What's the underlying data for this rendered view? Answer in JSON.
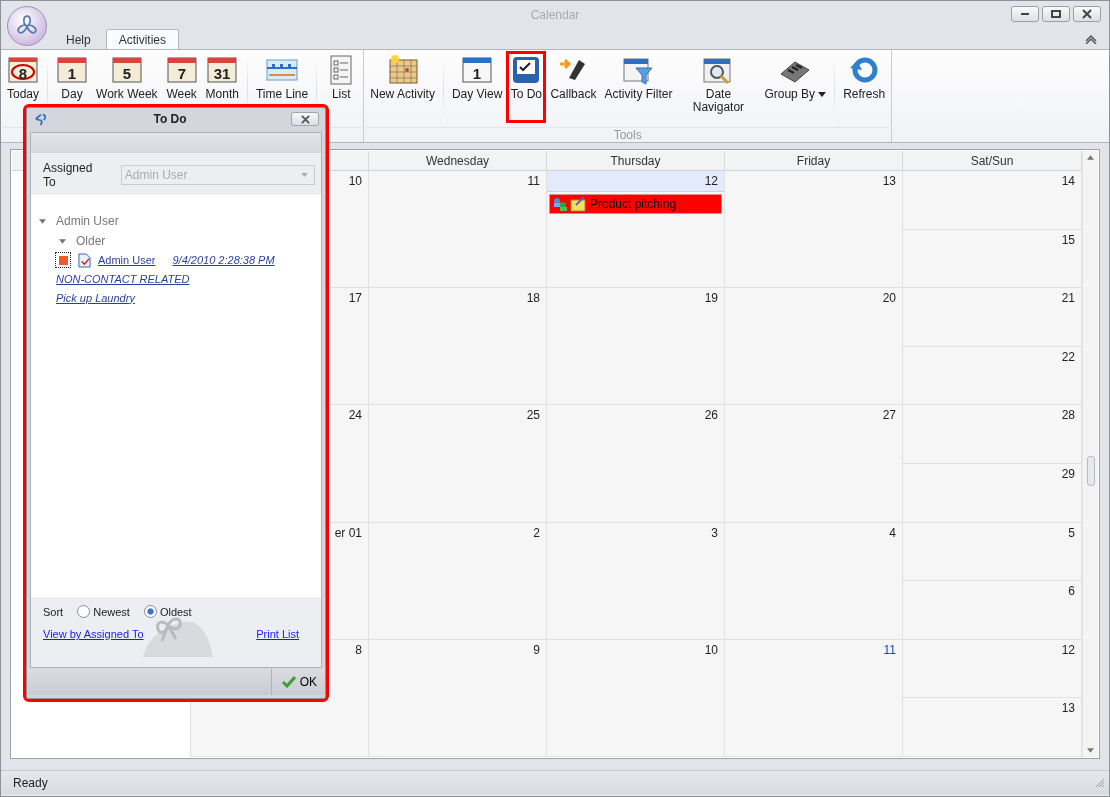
{
  "window": {
    "title": "Calendar"
  },
  "tabs": [
    {
      "label": "Help",
      "selected": false
    },
    {
      "label": "Activities",
      "selected": true
    }
  ],
  "ribbon": {
    "groups": [
      {
        "sections": [
          [
            {
              "label": "Today",
              "kind": "today",
              "icon_text": "8",
              "highlighted": false
            }
          ],
          [
            {
              "label": "Day",
              "kind": "calendar",
              "icon_text": "1",
              "highlighted": false
            },
            {
              "label": "Work Week",
              "kind": "calendar",
              "icon_text": "5",
              "highlighted": false
            },
            {
              "label": "Week",
              "kind": "calendar",
              "icon_text": "7",
              "highlighted": false
            },
            {
              "label": "Month",
              "kind": "calendar",
              "icon_text": "31",
              "highlighted": false
            }
          ],
          [
            {
              "label": "Time Line",
              "kind": "timeline",
              "highlighted": false
            }
          ],
          [
            {
              "label": "List",
              "kind": "list",
              "highlighted": false
            }
          ]
        ]
      },
      {
        "label": "Tools",
        "sections": [
          [
            {
              "label": "New Activity",
              "kind": "new-activity",
              "highlighted": false
            }
          ],
          [
            {
              "label": "Day View",
              "kind": "day-view",
              "icon_text": "1",
              "highlighted": false
            },
            {
              "label": "To Do",
              "kind": "todo",
              "highlighted": true
            },
            {
              "label": "Callback",
              "kind": "callback",
              "highlighted": false
            },
            {
              "label": "Activity Filter",
              "kind": "filter",
              "highlighted": false
            },
            {
              "label": "Date Navigator",
              "kind": "navigator",
              "highlighted": false
            },
            {
              "label": "Group By",
              "kind": "group",
              "has_menu": true,
              "highlighted": false
            }
          ],
          [
            {
              "label": "Refresh",
              "kind": "refresh",
              "highlighted": false
            }
          ]
        ]
      }
    ]
  },
  "calendar": {
    "columns": [
      "Wednesday",
      "Thursday",
      "Friday",
      "Sat/Sun"
    ],
    "weeks": [
      {
        "days": [
          {
            "date": "10",
            "today": false,
            "marked": false
          },
          {
            "date": "11",
            "today": false,
            "marked": false
          },
          {
            "date": "12",
            "today": true,
            "marked": false,
            "events": [
              {
                "title": "Product pitching",
                "color": "#ff0000"
              }
            ]
          },
          {
            "date": "13",
            "today": false,
            "marked": false
          }
        ],
        "weekend": [
          {
            "date": "14",
            "marked": false
          },
          {
            "date": "15",
            "marked": false
          }
        ]
      },
      {
        "days": [
          {
            "date": "17",
            "today": false,
            "marked": false
          },
          {
            "date": "18",
            "today": false,
            "marked": false
          },
          {
            "date": "19",
            "today": false,
            "marked": false
          },
          {
            "date": "20",
            "today": false,
            "marked": false
          }
        ],
        "weekend": [
          {
            "date": "21",
            "marked": false
          },
          {
            "date": "22",
            "marked": false
          }
        ]
      },
      {
        "days": [
          {
            "date": "24",
            "today": false,
            "marked": false
          },
          {
            "date": "25",
            "today": false,
            "marked": false
          },
          {
            "date": "26",
            "today": false,
            "marked": false
          },
          {
            "date": "27",
            "today": false,
            "marked": false
          }
        ],
        "weekend": [
          {
            "date": "28",
            "marked": false
          },
          {
            "date": "29",
            "marked": false
          }
        ]
      },
      {
        "days": [
          {
            "date": "er 01",
            "today": false,
            "marked": false
          },
          {
            "date": "2",
            "today": false,
            "marked": false
          },
          {
            "date": "3",
            "today": false,
            "marked": false
          },
          {
            "date": "4",
            "today": false,
            "marked": false
          }
        ],
        "weekend": [
          {
            "date": "5",
            "marked": false
          },
          {
            "date": "6",
            "marked": false
          }
        ]
      },
      {
        "days": [
          {
            "date": "8",
            "today": false,
            "marked": false
          },
          {
            "date": "9",
            "today": false,
            "marked": false
          },
          {
            "date": "10",
            "today": false,
            "marked": false
          },
          {
            "date": "11",
            "today": false,
            "marked": true
          }
        ],
        "weekend": [
          {
            "date": "12",
            "marked": false
          },
          {
            "date": "13",
            "marked": false
          }
        ]
      }
    ]
  },
  "dialog": {
    "title": "To Do",
    "highlighted": true,
    "assigned_to": {
      "label": "Assigned To",
      "value": "Admin User",
      "disabled": true
    },
    "tree": [
      {
        "label": "Admin User",
        "expanded": true,
        "children": [
          {
            "label": "Older",
            "expanded": true,
            "items": [
              {
                "assignee": "Admin User",
                "date": "9/4/2010 2:28:38 PM",
                "category": "NON-CONTACT RELATED",
                "subject": "Pick up Laundry"
              }
            ]
          }
        ]
      }
    ],
    "sort": {
      "label": "Sort",
      "options": [
        {
          "label": "Newest",
          "selected": false
        },
        {
          "label": "Oldest",
          "selected": true
        }
      ]
    },
    "links": [
      "View by Assigned To",
      "Print List"
    ],
    "ok_button": "OK"
  },
  "status_bar": "Ready"
}
